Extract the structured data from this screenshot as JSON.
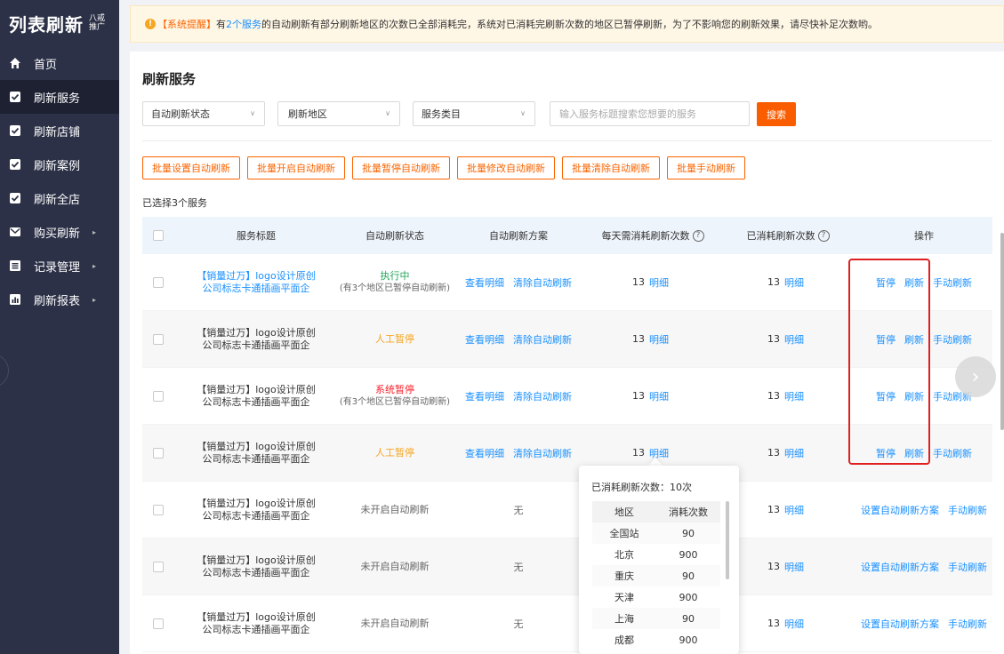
{
  "brand": {
    "name": "列表刷新",
    "sub1": "八戒",
    "sub2": "推广"
  },
  "nav": [
    {
      "label": "首页",
      "icon": "home-icon"
    },
    {
      "label": "刷新服务",
      "icon": "checkbox-icon",
      "active": true
    },
    {
      "label": "刷新店铺",
      "icon": "checkbox-icon"
    },
    {
      "label": "刷新案例",
      "icon": "checkbox-icon"
    },
    {
      "label": "刷新全店",
      "icon": "checkbox-icon"
    },
    {
      "label": "购买刷新",
      "icon": "mail-icon",
      "arrow": true
    },
    {
      "label": "记录管理",
      "icon": "list-icon",
      "arrow": true
    },
    {
      "label": "刷新报表",
      "icon": "chart-icon",
      "arrow": true
    }
  ],
  "alert": {
    "tag": "【系统提醒】",
    "pre": "有",
    "count": "2个服务",
    "msg": "的自动刷新有部分刷新地区的次数已全部消耗完，系统对已消耗完刷新次数的地区已暂停刷新，为了不影响您的刷新效果，请尽快补足次数哟。"
  },
  "page": {
    "title": "刷新服务",
    "filters": {
      "status": "自动刷新状态",
      "region": "刷新地区",
      "category": "服务类目"
    },
    "search_placeholder": "输入服务标题搜索您想要的服务",
    "search_btn": "搜索",
    "batch": [
      "批量设置自动刷新",
      "批量开启自动刷新",
      "批量暂停自动刷新",
      "批量修改自动刷新",
      "批量清除自动刷新",
      "批量手动刷新"
    ],
    "selected": "已选择3个服务"
  },
  "table": {
    "headers": {
      "title": "服务标题",
      "status": "自动刷新状态",
      "plan": "自动刷新方案",
      "daily": "每天需消耗刷新次数",
      "used": "已消耗刷新次数",
      "ops": "操作"
    },
    "rows": [
      {
        "title": "【销量过万】logo设计原创公司标志卡通插画平面企",
        "title_link": true,
        "status": "执行中",
        "status_color": "green",
        "status_sub": "(有3个地区已暂停自动刷新)",
        "plan_a": "查看明细",
        "plan_b": "清除自动刷新",
        "daily_n": "13",
        "daily_l": "明细",
        "used_n": "13",
        "used_l": "明细",
        "ops": [
          "暂停",
          "刷新",
          "手动刷新"
        ]
      },
      {
        "title": "【销量过万】logo设计原创公司标志卡通插画平面企",
        "title_link": false,
        "status": "人工暂停",
        "status_color": "amber",
        "status_sub": "",
        "plan_a": "查看明细",
        "plan_b": "清除自动刷新",
        "daily_n": "13",
        "daily_l": "明细",
        "used_n": "13",
        "used_l": "明细",
        "ops": [
          "暂停",
          "刷新",
          "手动刷新"
        ]
      },
      {
        "title": "【销量过万】logo设计原创公司标志卡通插画平面企",
        "title_link": false,
        "status": "系统暂停",
        "status_color": "red",
        "status_sub": "(有3个地区已暂停自动刷新)",
        "plan_a": "查看明细",
        "plan_b": "清除自动刷新",
        "daily_n": "13",
        "daily_l": "明细",
        "used_n": "13",
        "used_l": "明细",
        "ops": [
          "暂停",
          "刷新",
          "手动刷新"
        ]
      },
      {
        "title": "【销量过万】logo设计原创公司标志卡通插画平面企",
        "title_link": false,
        "status": "人工暂停",
        "status_color": "amber",
        "status_sub": "",
        "plan_a": "查看明细",
        "plan_b": "清除自动刷新",
        "daily_n": "13",
        "daily_l": "明细",
        "used_n": "13",
        "used_l": "明细",
        "ops": [
          "暂停",
          "刷新",
          "手动刷新"
        ]
      },
      {
        "title": "【销量过万】logo设计原创公司标志卡通插画平面企",
        "title_link": false,
        "status": "未开启自动刷新",
        "status_color": "grey",
        "status_sub": "",
        "plan_text": "无",
        "daily_n": "",
        "daily_l": "",
        "used_n": "13",
        "used_l": "明细",
        "ops": [
          "设置自动刷新方案",
          "手动刷新"
        ]
      },
      {
        "title": "【销量过万】logo设计原创公司标志卡通插画平面企",
        "title_link": false,
        "status": "未开启自动刷新",
        "status_color": "grey",
        "status_sub": "",
        "plan_text": "无",
        "daily_n": "",
        "daily_l": "",
        "used_n": "13",
        "used_l": "明细",
        "ops": [
          "设置自动刷新方案",
          "手动刷新"
        ]
      },
      {
        "title": "【销量过万】logo设计原创公司标志卡通插画平面企",
        "title_link": false,
        "status": "未开启自动刷新",
        "status_color": "grey",
        "status_sub": "",
        "plan_text": "无",
        "daily_n": "",
        "daily_l": "",
        "used_n": "13",
        "used_l": "明细",
        "ops": [
          "设置自动刷新方案",
          "手动刷新"
        ]
      }
    ]
  },
  "popover": {
    "title": "已消耗刷新次数：10次",
    "head": [
      "地区",
      "消耗次数"
    ],
    "rows": [
      [
        "全国站",
        "90"
      ],
      [
        "北京",
        "900"
      ],
      [
        "重庆",
        "90"
      ],
      [
        "天津",
        "900"
      ],
      [
        "上海",
        "90"
      ],
      [
        "成都",
        "900"
      ]
    ]
  },
  "colors": {
    "sidebar": "#2c3147",
    "accent": "#fa5c00",
    "link": "#1890ff",
    "running": "#22a65a",
    "manual_pause": "#f5a623",
    "system_pause": "#f5222d",
    "highlight": "#e02020"
  }
}
